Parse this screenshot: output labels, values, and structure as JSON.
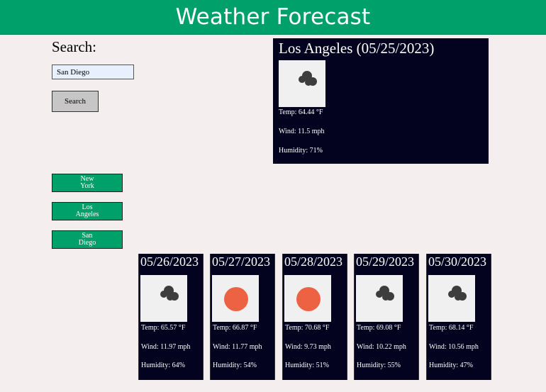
{
  "header": {
    "title": "Weather Forecast"
  },
  "search": {
    "label": "Search:",
    "value": "San Diego",
    "button_label": "Search"
  },
  "history": [
    {
      "label": "New York"
    },
    {
      "label": "Los Angeles"
    },
    {
      "label": "San Diego"
    }
  ],
  "current": {
    "title": "Los Angeles (05/25/2023)",
    "icon": "clouds-icon",
    "temp": "Temp: 64.44 °F",
    "wind": "Wind: 11.5 mph",
    "humidity": "Humidity: 71%"
  },
  "forecast": [
    {
      "date": "05/26/2023",
      "icon": "clouds-icon",
      "temp": "Temp: 65.57 °F",
      "wind": "Wind: 11.97 mph",
      "humidity": "Humidity: 64%"
    },
    {
      "date": "05/27/2023",
      "icon": "sun-icon",
      "temp": "Temp: 66.87 °F",
      "wind": "Wind: 11.77 mph",
      "humidity": "Humidity: 54%"
    },
    {
      "date": "05/28/2023",
      "icon": "sun-icon",
      "temp": "Temp: 70.68 °F",
      "wind": "Wind: 9.73 mph",
      "humidity": "Humidity: 51%"
    },
    {
      "date": "05/29/2023",
      "icon": "clouds-icon",
      "temp": "Temp: 69.08 °F",
      "wind": "Wind: 10.22 mph",
      "humidity": "Humidity: 55%"
    },
    {
      "date": "05/30/2023",
      "icon": "clouds-icon",
      "temp": "Temp: 68.14 °F",
      "wind": "Wind: 10.56 mph",
      "humidity": "Humidity: 47%"
    }
  ],
  "colors": {
    "header": "#00a06a",
    "panel": "#03031f",
    "sun": "#ee6244",
    "cloud": "#3d3d3d"
  }
}
